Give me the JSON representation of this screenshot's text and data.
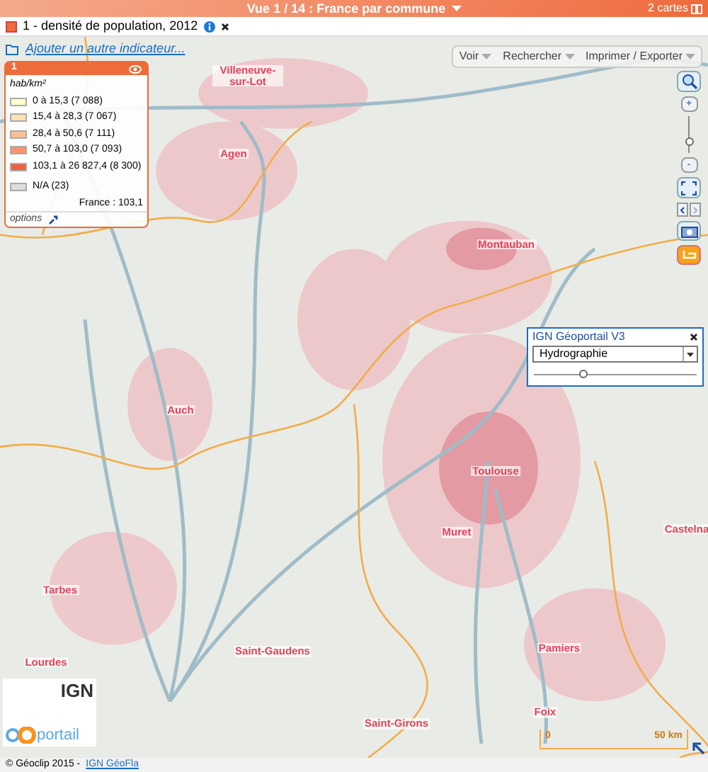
{
  "header": {
    "title": "Vue 1 / 14 : France par commune",
    "map_count": "2 cartes"
  },
  "indicator": {
    "label": "1 - densité de population, 2012"
  },
  "add_indicator_link": "Ajouter un autre indicateur...",
  "toolbar": [
    "Voir",
    "Rechercher",
    "Imprimer / Exporter"
  ],
  "legend": {
    "number": "1",
    "unit": "hab/km²",
    "classes": [
      {
        "label": "0 à 15,3 (7 088)",
        "color": "#ffffcc"
      },
      {
        "label": "15,4 à 28,3 (7 067)",
        "color": "#fde2b4"
      },
      {
        "label": "28,4 à 50,6 (7 111)",
        "color": "#fcc095"
      },
      {
        "label": "50,7 à 103,0 (7 093)",
        "color": "#f8946c"
      },
      {
        "label": "103,1 à 26 827,4 (8 300)",
        "color": "#f0603c"
      },
      {
        "label": "N/A (23)",
        "color": "#dddddd"
      }
    ],
    "reference": "France : 103,1",
    "options": "options"
  },
  "zoom": {
    "level": 0.3,
    "zoom_in": "+",
    "zoom_out": "-"
  },
  "cities": [
    "Villeneuve-sur-Lot",
    "Agen",
    "Montauban",
    "Auch",
    "Toulouse",
    "Muret",
    "Castelna",
    "Tarbes",
    "Lourdes",
    "Saint-Gaudens",
    "Pamiers",
    "Saint-Girons",
    "Foix"
  ],
  "layer_panel": {
    "title": "IGN Géoportail V3",
    "layer": "Hydrographie",
    "level": 0.3
  },
  "logos": {
    "ign": "IGN",
    "geoportail": "portail"
  },
  "scale": {
    "start": "0",
    "end": "50 km"
  },
  "footer": {
    "copyright": "© Géoclip 2015 -",
    "link": "IGN GéoFla"
  }
}
